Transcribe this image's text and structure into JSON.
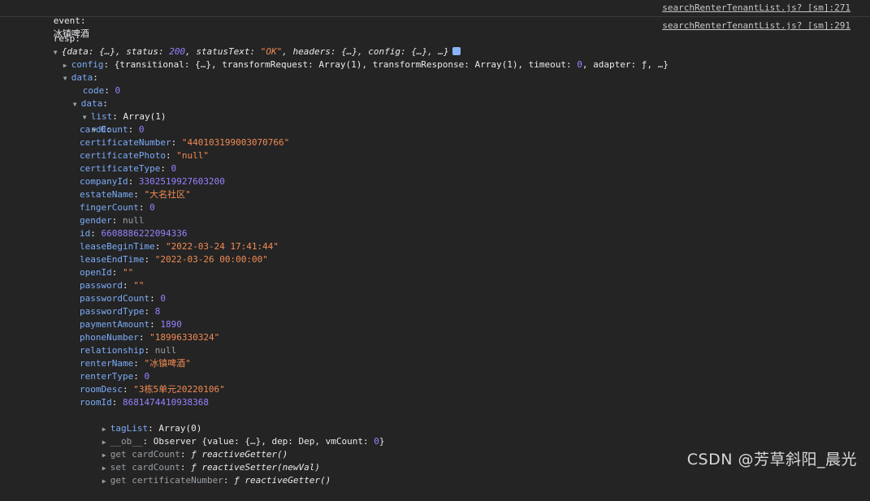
{
  "event_log": {
    "label": "event:",
    "value": "冰镇啤酒",
    "source": "searchRenterTenantList.js? [sm]:271"
  },
  "resp_log": {
    "label": "resp:",
    "source": "searchRenterTenantList.js? [sm]:291"
  },
  "summary": {
    "open": "{data: {…}, status: ",
    "status": "200",
    "mid": ", statusText: ",
    "statusText": "\"OK\"",
    "rest": ", headers: {…}, config: {…}, …}"
  },
  "config_line": {
    "key": "config",
    "rest_a": ": {transitional: {…}, transformRequest: Array(1), transformResponse: Array(1), timeout: ",
    "timeout": "0",
    "rest_b": ", adapter: ƒ, …}"
  },
  "data_key": "data",
  "code": {
    "key": "code",
    "value": "0"
  },
  "data_inner_key": "data",
  "list": {
    "key": "list",
    "value": "Array(1)"
  },
  "index": "0",
  "fields": [
    {
      "key": "cardCount",
      "value": "0",
      "type": "num"
    },
    {
      "key": "certificateNumber",
      "value": "\"440103199003070766\"",
      "type": "str"
    },
    {
      "key": "certificatePhoto",
      "value": "\"null\"",
      "type": "str"
    },
    {
      "key": "certificateType",
      "value": "0",
      "type": "num"
    },
    {
      "key": "companyId",
      "value": "3302519927603200",
      "type": "num"
    },
    {
      "key": "estateName",
      "value": "\"大名社区\"",
      "type": "str"
    },
    {
      "key": "fingerCount",
      "value": "0",
      "type": "num"
    },
    {
      "key": "gender",
      "value": "null",
      "type": "nul"
    },
    {
      "key": "id",
      "value": "6608886222094336",
      "type": "num"
    },
    {
      "key": "leaseBeginTime",
      "value": "\"2022-03-24 17:41:44\"",
      "type": "str"
    },
    {
      "key": "leaseEndTime",
      "value": "\"2022-03-26 00:00:00\"",
      "type": "str"
    },
    {
      "key": "openId",
      "value": "\"\"",
      "type": "str"
    },
    {
      "key": "password",
      "value": "\"\"",
      "type": "str"
    },
    {
      "key": "passwordCount",
      "value": "0",
      "type": "num"
    },
    {
      "key": "passwordType",
      "value": "8",
      "type": "num"
    },
    {
      "key": "paymentAmount",
      "value": "1890",
      "type": "num"
    },
    {
      "key": "phoneNumber",
      "value": "\"18996330324\"",
      "type": "str"
    },
    {
      "key": "relationship",
      "value": "null",
      "type": "nul"
    },
    {
      "key": "renterName",
      "value": "\"冰镇啤酒\"",
      "type": "str"
    },
    {
      "key": "renterType",
      "value": "0",
      "type": "num"
    },
    {
      "key": "roomDesc",
      "value": "\"3栋5单元20220106\"",
      "type": "str"
    },
    {
      "key": "roomId",
      "value": "8681474410938368",
      "type": "num"
    }
  ],
  "tagList": {
    "key": "tagList",
    "value": "Array(0)"
  },
  "ob": {
    "key": "__ob__",
    "rest_a": ": Observer {value: {…}, dep: Dep, vmCount: ",
    "count": "0",
    "rest_b": "}"
  },
  "getters": [
    {
      "prefix": "get cardCount",
      "colon": ": ",
      "f": "ƒ ",
      "fn": "reactiveGetter()"
    },
    {
      "prefix": "set cardCount",
      "colon": ": ",
      "f": "ƒ ",
      "fn": "reactiveSetter(newVal)"
    },
    {
      "prefix": "get certificateNumber",
      "colon": ": ",
      "f": "ƒ ",
      "fn": "reactiveGetter()"
    }
  ],
  "watermark": "CSDN @芳草斜阳_晨光"
}
